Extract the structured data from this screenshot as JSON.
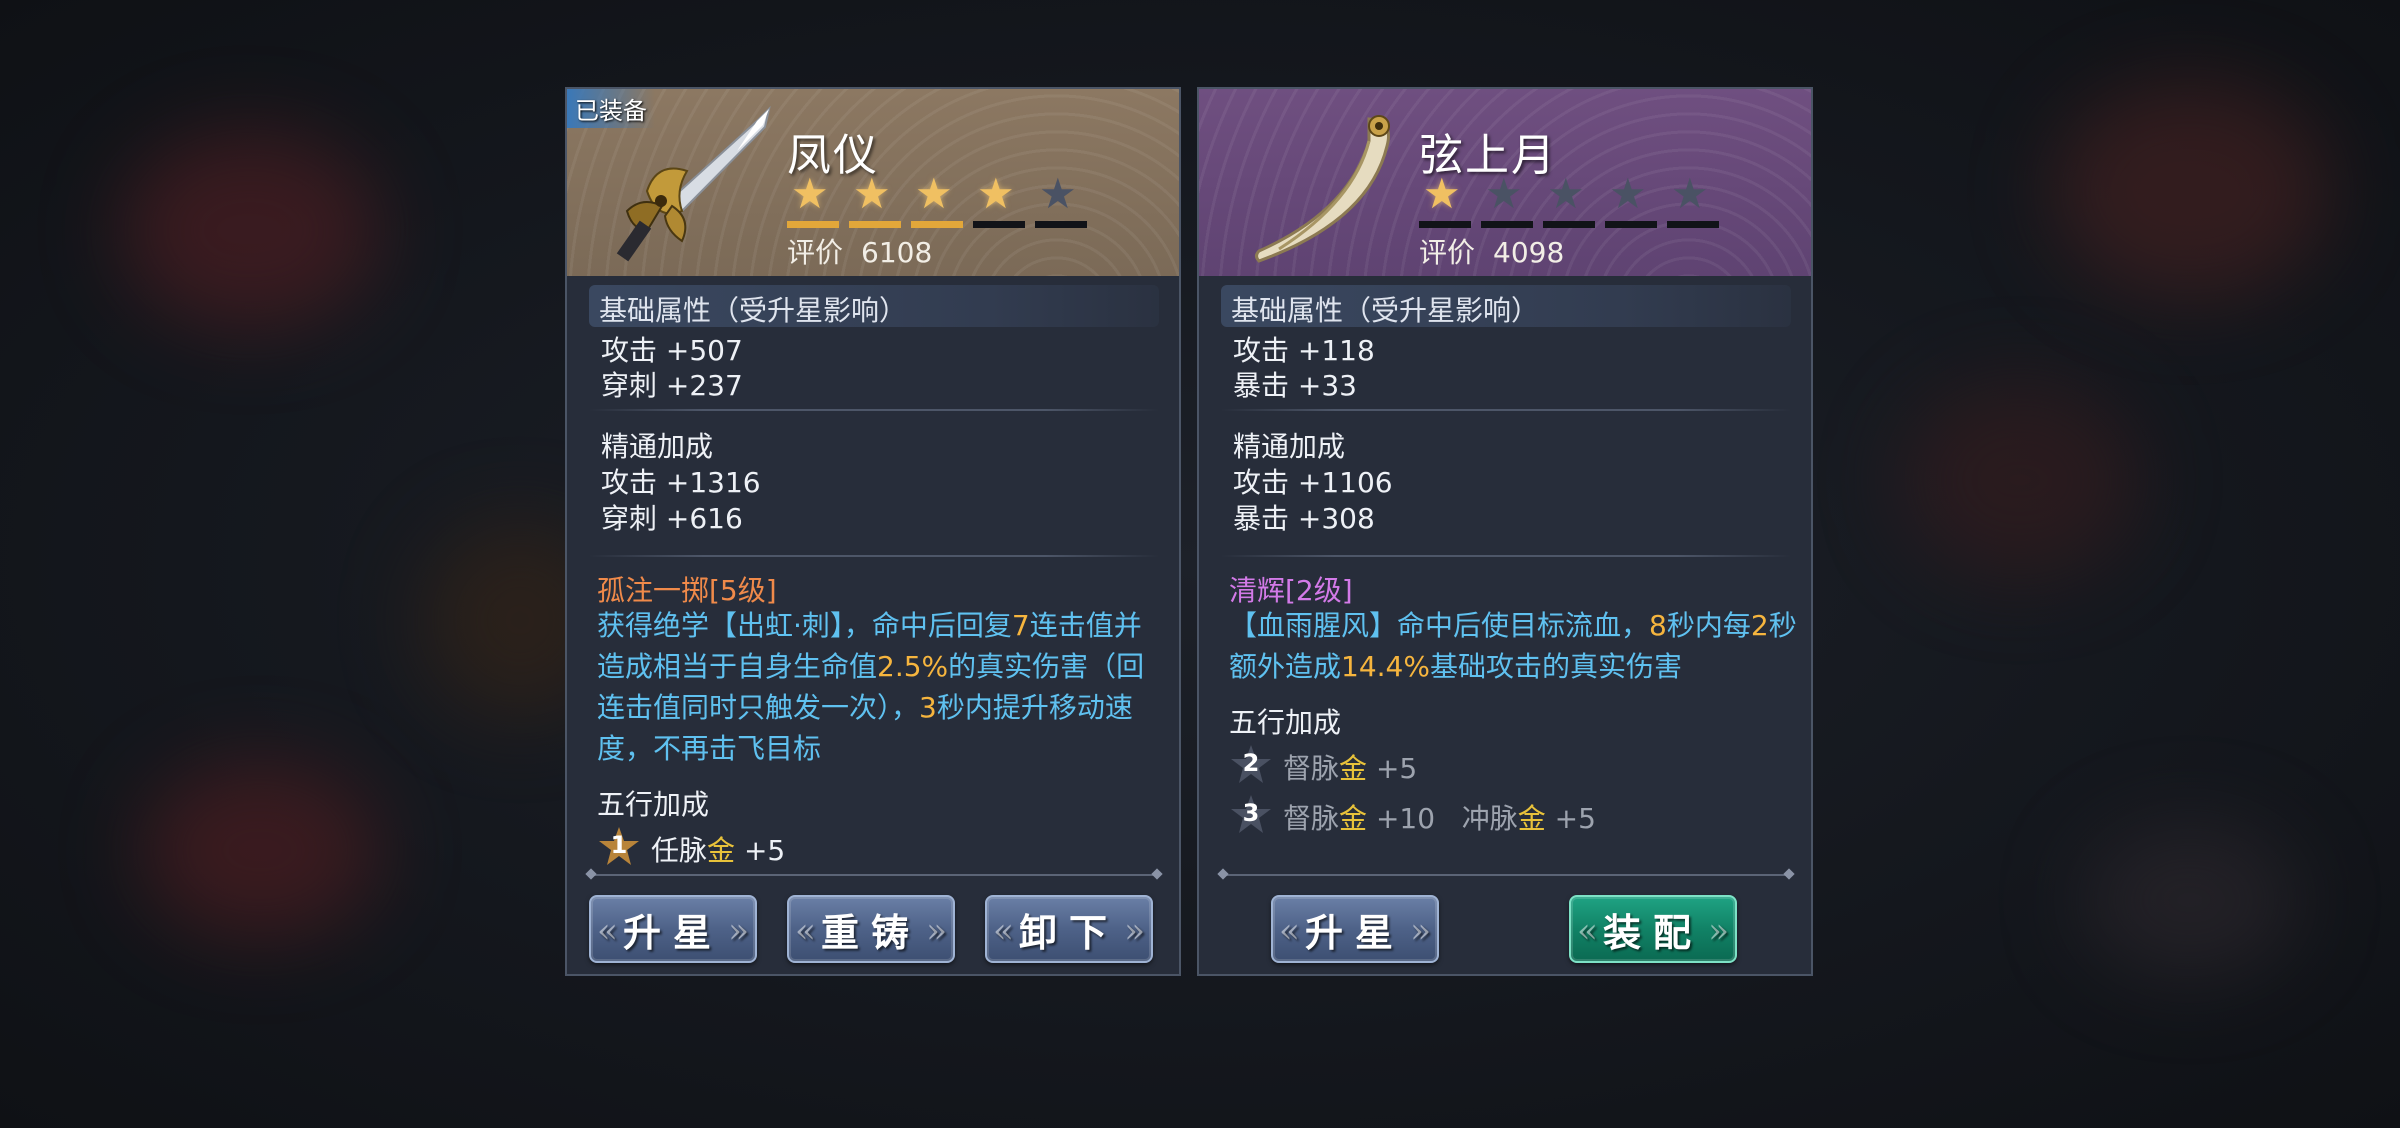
{
  "colors": {
    "skill_orange": "#f08a4a",
    "skill_purple": "#d37ae8",
    "desc_blue": "#5fc1f0",
    "highlight_gold": "#f6b53e",
    "button_blue": "#4e6288",
    "button_green": "#118266"
  },
  "left_card": {
    "equipped_tag": "已装备",
    "name": "凤仪",
    "stars_filled": 4,
    "stars_total": 5,
    "rating_label": "评价",
    "rating_value": "6108",
    "base_section_title": "基础属性（受升星影响）",
    "base_stats": [
      "攻击 +507",
      "穿刺 +237"
    ],
    "mastery_title": "精通加成",
    "mastery_stats": [
      "攻击 +1316",
      "穿刺 +616"
    ],
    "skill_title": "孤注一掷[5级]",
    "skill_desc": {
      "p1": "获得绝学【出虹·刺】，命中后回复",
      "n1": "7",
      "p2": "连击值并造成相当于自身生命值",
      "n2": "2.5%",
      "p3": "的真实伤害（回连击值同时只触发一次），",
      "n3": "3",
      "p4": "秒内提升移动速度，不再击飞目标"
    },
    "wuxing_title": "五行加成",
    "wuxing": [
      {
        "star": "1",
        "meridian": "任脉",
        "element": "金",
        "value": "+5",
        "lit": true
      }
    ],
    "buttons": {
      "upgrade": "升星",
      "reforge": "重铸",
      "unequip": "卸下"
    },
    "icon": "spear-blade-icon"
  },
  "right_card": {
    "name": "弦上月",
    "stars_filled": 1,
    "stars_total": 5,
    "rating_label": "评价",
    "rating_value": "4098",
    "base_section_title": "基础属性（受升星影响）",
    "base_stats": [
      "攻击 +118",
      "暴击 +33"
    ],
    "mastery_title": "精通加成",
    "mastery_stats": [
      "攻击 +1106",
      "暴击 +308"
    ],
    "skill_title": "清辉[2级]",
    "skill_desc": {
      "p1": "【血雨腥风】命中后使目标流血，",
      "n1": "8",
      "p2": "秒内每",
      "n2": "2",
      "p3": "秒额外造成",
      "n3": "14.4%",
      "p4": "基础攻击的真实伤害"
    },
    "wuxing_title": "五行加成",
    "wuxing": [
      {
        "star": "2",
        "meridian": "督脉",
        "element": "金",
        "value": "+5",
        "lit": false
      },
      {
        "star": "3",
        "meridian": "督脉",
        "element": "金",
        "value": "+10",
        "meridian2": "冲脉",
        "element2": "金",
        "value2": "+5",
        "lit": false
      }
    ],
    "buttons": {
      "upgrade": "升星",
      "equip": "装配"
    },
    "icon": "crescent-blade-icon"
  }
}
